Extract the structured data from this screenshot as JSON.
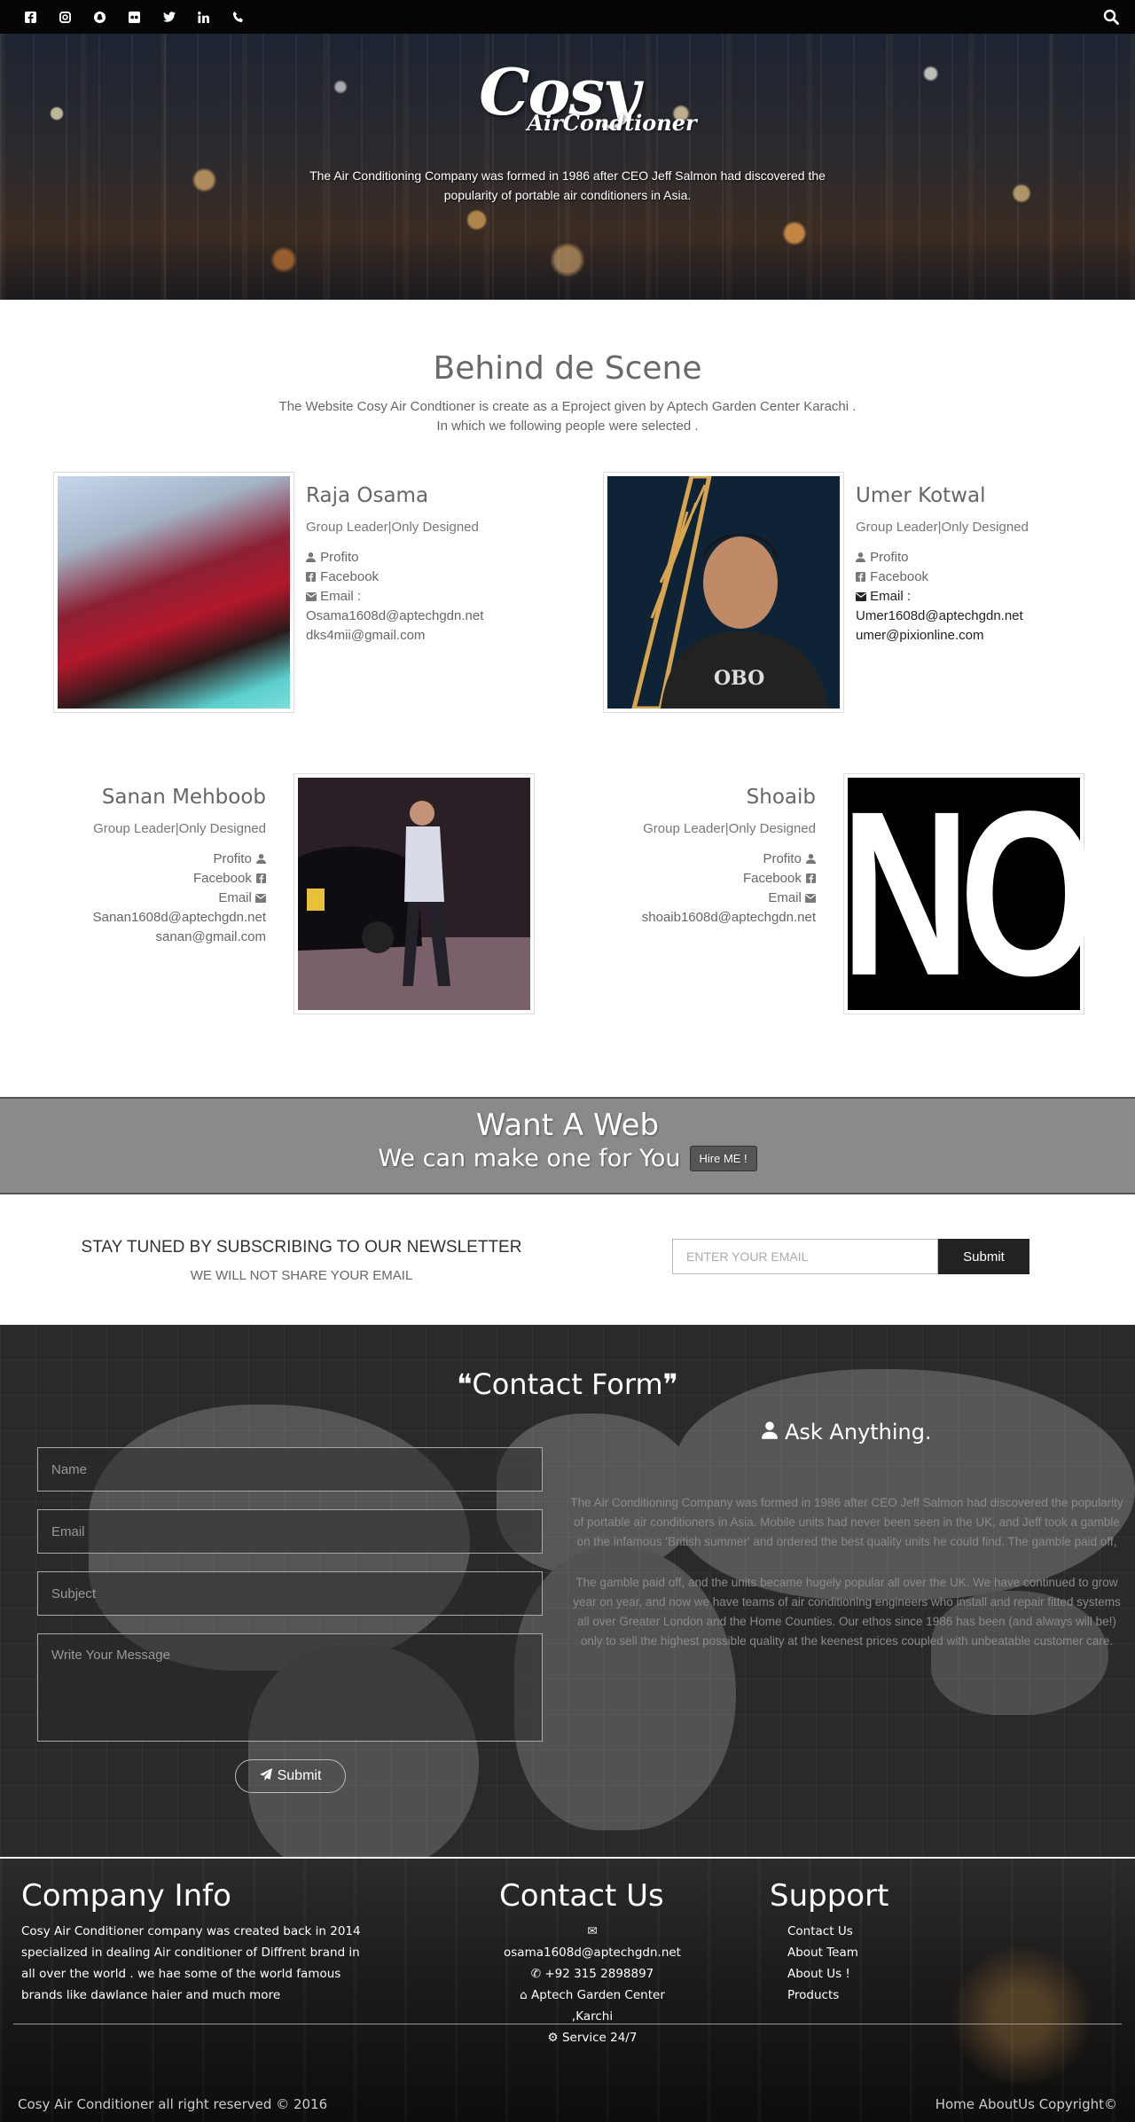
{
  "topbar": {
    "icons": [
      {
        "name": "facebook-icon",
        "glyph": "f"
      },
      {
        "name": "instagram-icon",
        "glyph": "◙"
      },
      {
        "name": "snapchat-icon",
        "glyph": "☗"
      },
      {
        "name": "flickr-icon",
        "glyph": "●●"
      },
      {
        "name": "twitter-icon",
        "glyph": "🐦"
      },
      {
        "name": "linkedin-icon",
        "glyph": "in"
      },
      {
        "name": "phone-icon",
        "glyph": "✆"
      }
    ],
    "search_icon": "search-icon"
  },
  "hero": {
    "logo_main": "Cosy",
    "logo_sub": "AirCondtioner",
    "text": "The Air Conditioning Company was formed in 1986 after CEO Jeff Salmon had discovered the popularity of portable air conditioners in Asia."
  },
  "team": {
    "title": "Behind de Scene",
    "subtitle_1": "The Website Cosy Air Condtioner is create as a Eproject given by Aptech Garden Center Karachi .",
    "subtitle_2": "In which we following people were selected .",
    "members": [
      {
        "name": "Raja Osama",
        "role": "Group Leader|Only Designed",
        "profile": "Profito",
        "facebook": "Facebook",
        "email_label": "Email :",
        "email_1": "Osama1608d@aptechgdn.net",
        "email_2": "dks4mii@gmail.com"
      },
      {
        "name": "Umer Kotwal",
        "role": "Group Leader|Only Designed",
        "profile": "Profito",
        "facebook": "Facebook",
        "email_label": "Email :",
        "email_1": "Umer1608d@aptechgdn.net",
        "email_2": "umer@pixionline.com"
      },
      {
        "name": "Sanan Mehboob",
        "role": "Group Leader|Only Designed",
        "profile": "Profito",
        "facebook": "Facebook",
        "email_label": "Email",
        "email_1": "Sanan1608d@aptechgdn.net",
        "email_2": "sanan@gmail.com"
      },
      {
        "name": "Shoaib",
        "role": "Group Leader|Only Designed",
        "profile": "Profito",
        "facebook": "Facebook",
        "email_label": "Email",
        "email_1": "shoaib1608d@aptechgdn.net",
        "image_text": "NO"
      }
    ]
  },
  "hire": {
    "title": "Want A Web",
    "subtitle": "We can make one for You",
    "button": "Hire ME !"
  },
  "newsletter": {
    "title": "STAY TUNED BY SUBSCRIBING TO OUR NEWSLETTER",
    "subtitle": "WE WILL NOT SHARE YOUR EMAIL",
    "placeholder": "ENTER YOUR EMAIL",
    "button": "Submit"
  },
  "contact": {
    "title": "Contact Form",
    "name_placeholder": "Name",
    "email_placeholder": "Email",
    "subject_placeholder": "Subject",
    "message_placeholder": "Write Your Message",
    "submit": "Submit",
    "ask_title": "Ask Anything.",
    "ask_p1": "The Air Conditioning Company was formed in 1986 after CEO Jeff Salmon had discovered the popularity of portable air conditioners in Asia. Mobile units had never been seen in the UK, and Jeff took a gamble on the infamous 'British summer' and ordered the best quality units he could find. The gamble paid off,",
    "ask_p2": "The gamble paid off, and the units became hugely popular all over the UK. We have continued to grow year on year, and now we have teams of air conditioning engineers who install and repair fitted systems all over Greater London and the Home Counties. Our ethos since 1986 has been (and always will be!) only to sell the highest possible quality at the keenest prices coupled with unbeatable customer care."
  },
  "footer": {
    "company_title": "Company Info",
    "company_text": "Cosy Air Conditioner company was created back in 2014 specialized in dealing Air conditioner of Diffrent brand in all over the world . we hae some of the world famous brands like dawlance haier and much more",
    "contact_title": "Contact Us",
    "contact_email": "osama1608d@aptechgdn.net",
    "contact_phone": "+92 315 2898897",
    "contact_address": "Aptech Garden Center ,Karchi",
    "contact_service": "Service 24/7",
    "support_title": "Support",
    "support_links": [
      "Contact Us",
      "About Team",
      "About Us !",
      "Products"
    ],
    "copyright": "Cosy Air Conditioner all right reserved © 2016",
    "bottom_links": "Home AboutUs Copyright©"
  }
}
